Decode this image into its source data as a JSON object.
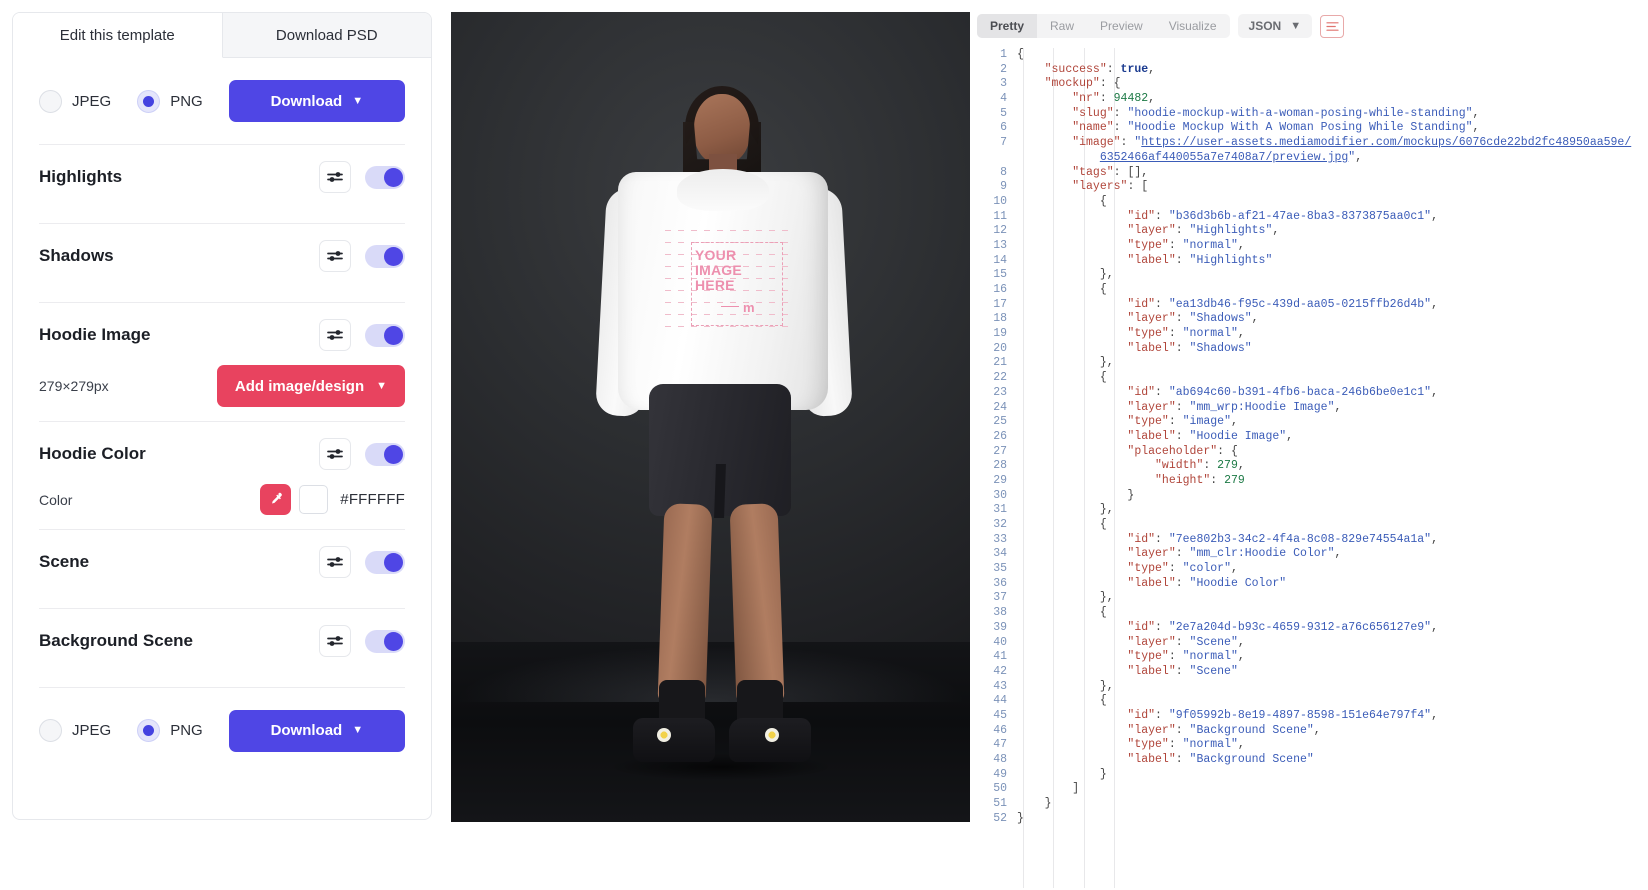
{
  "sidebar": {
    "tabs": [
      {
        "label": "Edit this template",
        "active": true
      },
      {
        "label": "Download PSD",
        "active": false
      }
    ],
    "format_top": {
      "options": [
        {
          "label": "JPEG",
          "checked": false
        },
        {
          "label": "PNG",
          "checked": true
        }
      ],
      "download_label": "Download",
      "chevron": "chevron-down-icon"
    },
    "format_bottom": {
      "options": [
        {
          "label": "JPEG",
          "checked": false
        },
        {
          "label": "PNG",
          "checked": true
        }
      ],
      "download_label": "Download",
      "chevron": "chevron-down-icon"
    },
    "layers": [
      {
        "title": "Highlights",
        "toggle_on": true,
        "settings_icon": "sliders-icon"
      },
      {
        "title": "Shadows",
        "toggle_on": true,
        "settings_icon": "sliders-icon"
      },
      {
        "title": "Hoodie Image",
        "toggle_on": true,
        "settings_icon": "sliders-icon",
        "sub_label": "279×279px",
        "action_label": "Add image/design"
      },
      {
        "title": "Hoodie Color",
        "toggle_on": true,
        "settings_icon": "sliders-icon",
        "sub_label": "Color",
        "hex": "#FFFFFF",
        "swatch_color": "#FFFFFF",
        "eyedropper_icon": "eyedropper-icon"
      },
      {
        "title": "Scene",
        "toggle_on": true,
        "settings_icon": "sliders-icon"
      },
      {
        "title": "Background Scene",
        "toggle_on": true,
        "settings_icon": "sliders-icon"
      }
    ]
  },
  "mockup": {
    "placeholder_line1": "YOUR",
    "placeholder_line2": "IMAGE",
    "placeholder_line3": "HERE",
    "placeholder_mark": "m"
  },
  "json_panel": {
    "tabs": [
      {
        "label": "Pretty",
        "active": true
      },
      {
        "label": "Raw",
        "active": false
      },
      {
        "label": "Preview",
        "active": false
      },
      {
        "label": "Visualize",
        "active": false
      }
    ],
    "format_select": "JSON",
    "format_chevron": "chevron-down-icon",
    "wrap_button_icon": "text-wrap-icon",
    "lines": [
      {
        "n": 1,
        "html": "<span class='p'>{</span>"
      },
      {
        "n": 2,
        "html": "    <span class='k'>\"success\"</span><span class='p'>: </span><span class='b'>true</span><span class='p'>,</span>"
      },
      {
        "n": 3,
        "html": "    <span class='k'>\"mockup\"</span><span class='p'>: {</span>"
      },
      {
        "n": 4,
        "html": "        <span class='k'>\"nr\"</span><span class='p'>: </span><span class='n'>94482</span><span class='p'>,</span>"
      },
      {
        "n": 5,
        "html": "        <span class='k'>\"slug\"</span><span class='p'>: </span><span class='s'>\"hoodie-mockup-with-a-woman-posing-while-standing\"</span><span class='p'>,</span>"
      },
      {
        "n": 6,
        "html": "        <span class='k'>\"name\"</span><span class='p'>: </span><span class='s'>\"Hoodie Mockup With A Woman Posing While Standing\"</span><span class='p'>,</span>"
      },
      {
        "n": 7,
        "html": "        <span class='k'>\"image\"</span><span class='p'>: </span><span class='s'>\"</span><span class='u'>https://user-assets.mediamodifier.com/mockups/6076cde22bd2fc48950aa59e/</span>"
      },
      {
        "n": "",
        "html": "            <span class='u'>6352466af440055a7e7408a7/preview.jpg</span><span class='s'>\"</span><span class='p'>,</span>"
      },
      {
        "n": 8,
        "html": "        <span class='k'>\"tags\"</span><span class='p'>: [],</span>"
      },
      {
        "n": 9,
        "html": "        <span class='k'>\"layers\"</span><span class='p'>: [</span>"
      },
      {
        "n": 10,
        "html": "            <span class='p'>{</span>"
      },
      {
        "n": 11,
        "html": "                <span class='k'>\"id\"</span><span class='p'>: </span><span class='s'>\"b36d3b6b-af21-47ae-8ba3-8373875aa0c1\"</span><span class='p'>,</span>"
      },
      {
        "n": 12,
        "html": "                <span class='k'>\"layer\"</span><span class='p'>: </span><span class='s'>\"Highlights\"</span><span class='p'>,</span>"
      },
      {
        "n": 13,
        "html": "                <span class='k'>\"type\"</span><span class='p'>: </span><span class='s'>\"normal\"</span><span class='p'>,</span>"
      },
      {
        "n": 14,
        "html": "                <span class='k'>\"label\"</span><span class='p'>: </span><span class='s'>\"Highlights\"</span>"
      },
      {
        "n": 15,
        "html": "            <span class='p'>},</span>"
      },
      {
        "n": 16,
        "html": "            <span class='p'>{</span>"
      },
      {
        "n": 17,
        "html": "                <span class='k'>\"id\"</span><span class='p'>: </span><span class='s'>\"ea13db46-f95c-439d-aa05-0215ffb26d4b\"</span><span class='p'>,</span>"
      },
      {
        "n": 18,
        "html": "                <span class='k'>\"layer\"</span><span class='p'>: </span><span class='s'>\"Shadows\"</span><span class='p'>,</span>"
      },
      {
        "n": 19,
        "html": "                <span class='k'>\"type\"</span><span class='p'>: </span><span class='s'>\"normal\"</span><span class='p'>,</span>"
      },
      {
        "n": 20,
        "html": "                <span class='k'>\"label\"</span><span class='p'>: </span><span class='s'>\"Shadows\"</span>"
      },
      {
        "n": 21,
        "html": "            <span class='p'>},</span>"
      },
      {
        "n": 22,
        "html": "            <span class='p'>{</span>"
      },
      {
        "n": 23,
        "html": "                <span class='k'>\"id\"</span><span class='p'>: </span><span class='s'>\"ab694c60-b391-4fb6-baca-246b6be0e1c1\"</span><span class='p'>,</span>"
      },
      {
        "n": 24,
        "html": "                <span class='k'>\"layer\"</span><span class='p'>: </span><span class='s'>\"mm_wrp:Hoodie Image\"</span><span class='p'>,</span>"
      },
      {
        "n": 25,
        "html": "                <span class='k'>\"type\"</span><span class='p'>: </span><span class='s'>\"image\"</span><span class='p'>,</span>"
      },
      {
        "n": 26,
        "html": "                <span class='k'>\"label\"</span><span class='p'>: </span><span class='s'>\"Hoodie Image\"</span><span class='p'>,</span>"
      },
      {
        "n": 27,
        "html": "                <span class='k'>\"placeholder\"</span><span class='p'>: {</span>"
      },
      {
        "n": 28,
        "html": "                    <span class='k'>\"width\"</span><span class='p'>: </span><span class='n'>279</span><span class='p'>,</span>"
      },
      {
        "n": 29,
        "html": "                    <span class='k'>\"height\"</span><span class='p'>: </span><span class='n'>279</span>"
      },
      {
        "n": 30,
        "html": "                <span class='p'>}</span>"
      },
      {
        "n": 31,
        "html": "            <span class='p'>},</span>"
      },
      {
        "n": 32,
        "html": "            <span class='p'>{</span>"
      },
      {
        "n": 33,
        "html": "                <span class='k'>\"id\"</span><span class='p'>: </span><span class='s'>\"7ee802b3-34c2-4f4a-8c08-829e74554a1a\"</span><span class='p'>,</span>"
      },
      {
        "n": 34,
        "html": "                <span class='k'>\"layer\"</span><span class='p'>: </span><span class='s'>\"mm_clr:Hoodie Color\"</span><span class='p'>,</span>"
      },
      {
        "n": 35,
        "html": "                <span class='k'>\"type\"</span><span class='p'>: </span><span class='s'>\"color\"</span><span class='p'>,</span>"
      },
      {
        "n": 36,
        "html": "                <span class='k'>\"label\"</span><span class='p'>: </span><span class='s'>\"Hoodie Color\"</span>"
      },
      {
        "n": 37,
        "html": "            <span class='p'>},</span>"
      },
      {
        "n": 38,
        "html": "            <span class='p'>{</span>"
      },
      {
        "n": 39,
        "html": "                <span class='k'>\"id\"</span><span class='p'>: </span><span class='s'>\"2e7a204d-b93c-4659-9312-a76c656127e9\"</span><span class='p'>,</span>"
      },
      {
        "n": 40,
        "html": "                <span class='k'>\"layer\"</span><span class='p'>: </span><span class='s'>\"Scene\"</span><span class='p'>,</span>"
      },
      {
        "n": 41,
        "html": "                <span class='k'>\"type\"</span><span class='p'>: </span><span class='s'>\"normal\"</span><span class='p'>,</span>"
      },
      {
        "n": 42,
        "html": "                <span class='k'>\"label\"</span><span class='p'>: </span><span class='s'>\"Scene\"</span>"
      },
      {
        "n": 43,
        "html": "            <span class='p'>},</span>"
      },
      {
        "n": 44,
        "html": "            <span class='p'>{</span>"
      },
      {
        "n": 45,
        "html": "                <span class='k'>\"id\"</span><span class='p'>: </span><span class='s'>\"9f05992b-8e19-4897-8598-151e64e797f4\"</span><span class='p'>,</span>"
      },
      {
        "n": 46,
        "html": "                <span class='k'>\"layer\"</span><span class='p'>: </span><span class='s'>\"Background Scene\"</span><span class='p'>,</span>"
      },
      {
        "n": 47,
        "html": "                <span class='k'>\"type\"</span><span class='p'>: </span><span class='s'>\"normal\"</span><span class='p'>,</span>"
      },
      {
        "n": 48,
        "html": "                <span class='k'>\"label\"</span><span class='p'>: </span><span class='s'>\"Background Scene\"</span>"
      },
      {
        "n": 49,
        "html": "            <span class='p'>}</span>"
      },
      {
        "n": 50,
        "html": "        <span class='p'>]</span>"
      },
      {
        "n": 51,
        "html": "    <span class='p'>}</span>"
      },
      {
        "n": 52,
        "html": "<span class='p'>}</span>"
      }
    ]
  }
}
